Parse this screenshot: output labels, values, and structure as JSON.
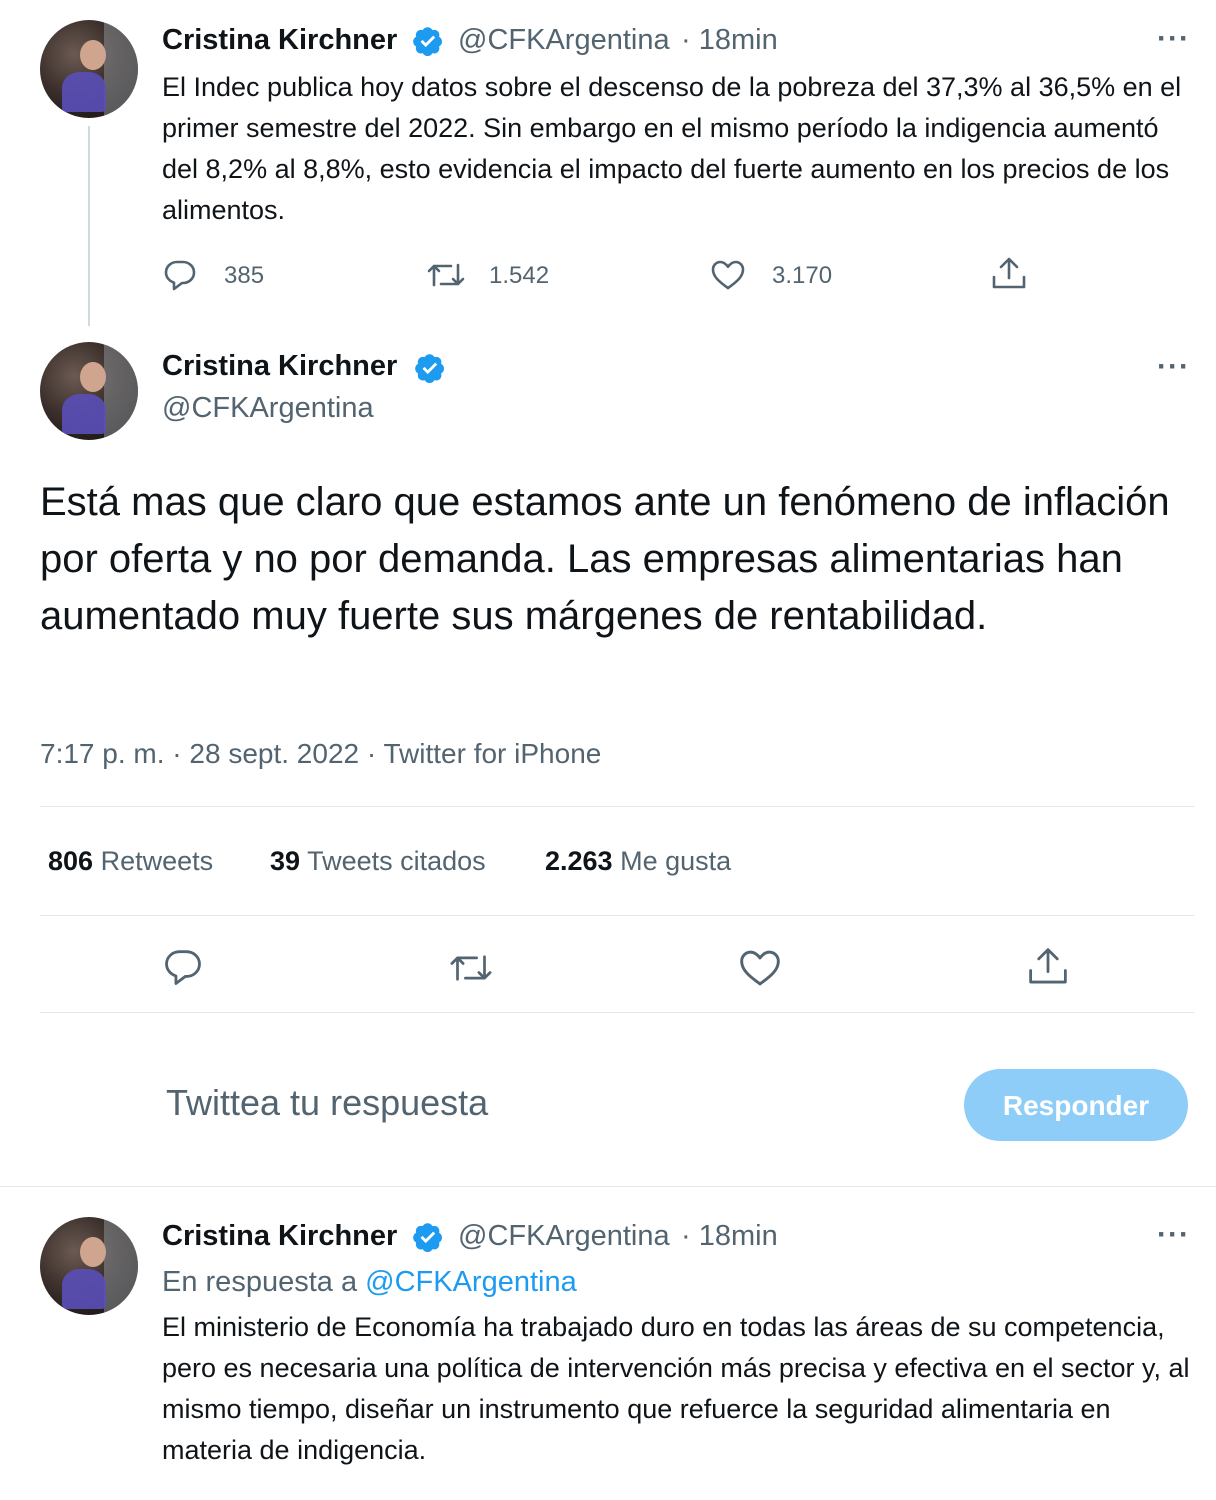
{
  "tweet1": {
    "name": "Cristina Kirchner",
    "handle": "@CFKArgentina",
    "time": "· 18min",
    "more": "···",
    "text": "El Indec publica hoy datos sobre el descenso de la pobreza del 37,3% al 36,5% en el primer semestre del 2022. Sin embargo en el mismo período la indigencia aumentó del 8,2% al 8,8%, esto evidencia el impacto del fuerte aumento en los precios de los alimentos.",
    "replies": "385",
    "retweets": "1.542",
    "likes": "3.170"
  },
  "tweet2": {
    "name": "Cristina Kirchner",
    "handle": "@CFKArgentina",
    "more": "···",
    "text": "Está mas que claro que estamos ante un fenómeno de inflación por oferta y no por demanda. Las empresas alimentarias han aumentado muy fuerte sus márgenes de rentabilidad.",
    "timestamp": "7:17 p. m. · 28 sept. 2022 · Twitter for iPhone",
    "stats": {
      "retweets_count": "806",
      "retweets_label": "Retweets",
      "quotes_count": "39",
      "quotes_label": "Tweets citados",
      "likes_count": "2.263",
      "likes_label": "Me gusta"
    }
  },
  "reply_box": {
    "placeholder": "Twittea tu respuesta",
    "button": "Responder"
  },
  "tweet3": {
    "name": "Cristina Kirchner",
    "handle": "@CFKArgentina",
    "time": "· 18min",
    "more": "···",
    "reply_prefix": "En respuesta a",
    "reply_to": "@CFKArgentina",
    "text": "El ministerio de Economía ha trabajado duro en todas las áreas de su competencia, pero es necesaria una política de intervención más precisa y efectiva en el sector y, al mismo tiempo, diseñar un instrumento que refuerce la seguridad alimentaria en materia de indigencia."
  },
  "colors": {
    "verified": "#1d9bf0",
    "secondary_text": "#536471",
    "button": "#8ecdf7"
  },
  "icons": [
    "verified-icon",
    "reply-icon",
    "retweet-icon",
    "like-icon",
    "share-icon",
    "more-icon"
  ]
}
